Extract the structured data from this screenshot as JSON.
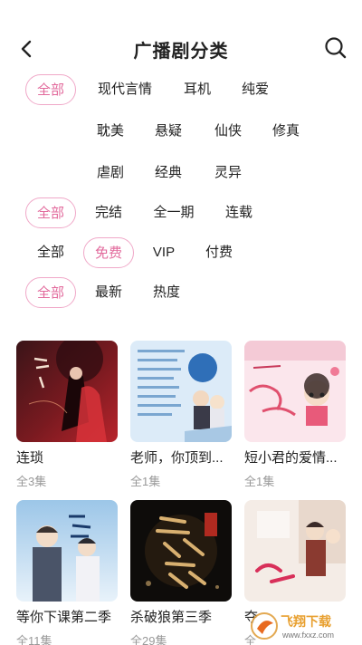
{
  "header": {
    "title": "广播剧分类"
  },
  "filters": {
    "category": [
      "全部",
      "现代言情",
      "耳机",
      "纯爱",
      "耽美",
      "悬疑",
      "仙侠",
      "修真",
      "虐剧",
      "经典",
      "灵异"
    ],
    "status": [
      "全部",
      "完结",
      "全一期",
      "连载"
    ],
    "price": [
      "全部",
      "免费",
      "VIP",
      "付费"
    ],
    "sort": [
      "全部",
      "最新",
      "热度"
    ]
  },
  "cards": [
    {
      "title": "连琐",
      "episodes": "全3集"
    },
    {
      "title": "老师，你顶到...",
      "episodes": "全1集"
    },
    {
      "title": "短小君的爱情...",
      "episodes": "全1集"
    },
    {
      "title": "等你下课第二季",
      "episodes": "全11集"
    },
    {
      "title": "杀破狼第三季",
      "episodes": "全29集"
    },
    {
      "title": "夺",
      "episodes": "全"
    }
  ],
  "watermark": {
    "text": "飞翔下载",
    "url": "www.fxxz.com"
  },
  "colors": {
    "accent": "#e26a9c",
    "chip_border": "#f0a8c8"
  }
}
